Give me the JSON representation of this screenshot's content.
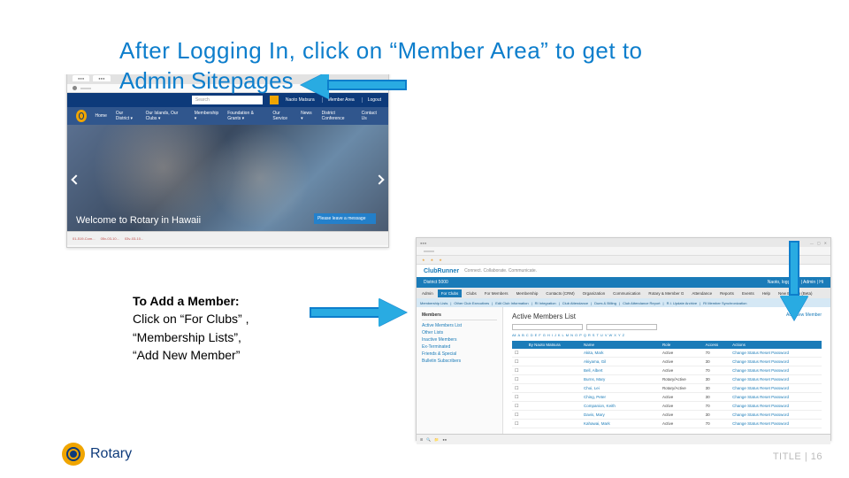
{
  "slide": {
    "title_line1": "After Logging In, click on “Member Area” to get to",
    "title_line2": "Admin Sitepages"
  },
  "instruction": {
    "heading": "To Add a Member:",
    "line1": "Click on “For Clubs” ,",
    "line2": "“Membership Lists”,",
    "line3": "“Add New Member”"
  },
  "screenshot1": {
    "search_placeholder": "Search",
    "header_links": [
      "Naoto Matsura",
      "Member Area",
      "Logout"
    ],
    "nav": [
      "Home",
      "Our District ▾",
      "Our Islands, Our Clubs ▾",
      "Membership ▾",
      "Foundation & Grants ▾",
      "Our Service",
      "News ▾",
      "District Conference",
      "Contact Us"
    ],
    "hero_text": "Welcome to Rotary in Hawaii",
    "overlay_msg": "Please leave a message",
    "taskbar": [
      "01-519-Com...",
      "05v-03-10...",
      "03v-03-10..."
    ]
  },
  "screenshot2": {
    "brand": "ClubRunner",
    "brand_tag": "Connect. Collaborate. Communicate.",
    "district_label": "District 5000",
    "district_user": "Naoto, logged in | Admin | Hi",
    "menu": [
      "Admin",
      "For Clubs",
      "Clubs",
      "For Members",
      "Membership",
      "Contacts (CRM)",
      "Organization",
      "Communication",
      "Rotary & Member G",
      "Attendance",
      "Reports",
      "Events",
      "Help",
      "New Bulletin (Beta)"
    ],
    "submenu": [
      "Membership Lists",
      "Other Club Executives",
      "Edit Club Information",
      "RI Integration",
      "Club Attendance",
      "Dues & Billing",
      "Club Attendance Report",
      "R.I. Update Archive",
      "RI Member Synchronization"
    ],
    "sidebar_heading": "Members",
    "sidebar_links": [
      "Active Members List",
      "Other Lists",
      "Inactive Members",
      "Ex-Terminated",
      "Friends & Special",
      "Bulletin Subscribers"
    ],
    "list_title": "Active Members List",
    "add_link": "Add New Member",
    "filter_all": "All",
    "columns": [
      "",
      "By Naoto Matsura",
      "Name",
      "",
      "",
      "",
      "Role",
      "Access",
      "Actions"
    ],
    "rows": [
      {
        "name": "Akita, Mark",
        "role": "Active",
        "access": "70",
        "actions": "Change Status  Reset Password"
      },
      {
        "name": "Akiyama, Gil",
        "role": "Active",
        "access": "30",
        "actions": "Change Status  Reset Password"
      },
      {
        "name": "Bell, Albert",
        "role": "Active",
        "access": "70",
        "actions": "Change Status  Reset Password"
      },
      {
        "name": "Burns, Mary",
        "role": "Rotary/Active",
        "access": "30",
        "actions": "Change Status  Reset Password"
      },
      {
        "name": "Choi, Lei",
        "role": "Rotary/Active",
        "access": "30",
        "actions": "Change Status  Reset Password"
      },
      {
        "name": "Ching, Peter",
        "role": "Active",
        "access": "30",
        "actions": "Change Status  Reset Password"
      },
      {
        "name": "Companion, Keith",
        "role": "Active",
        "access": "70",
        "actions": "Change Status  Reset Password"
      },
      {
        "name": "Davis, Mary",
        "role": "Active",
        "access": "30",
        "actions": "Change Status  Reset Password"
      },
      {
        "name": "Kahawai, Mark",
        "role": "Active",
        "access": "70",
        "actions": "Change Status  Reset Password"
      }
    ],
    "az": [
      "All",
      "A",
      "B",
      "C",
      "D",
      "E",
      "F",
      "G",
      "H",
      "I",
      "J",
      "K",
      "L",
      "M",
      "N",
      "O",
      "P",
      "Q",
      "R",
      "S",
      "T",
      "U",
      "V",
      "W",
      "X",
      "Y",
      "Z"
    ]
  },
  "footer": {
    "title": "TITLE",
    "page": "16"
  },
  "rotary": {
    "name": "Rotary"
  }
}
